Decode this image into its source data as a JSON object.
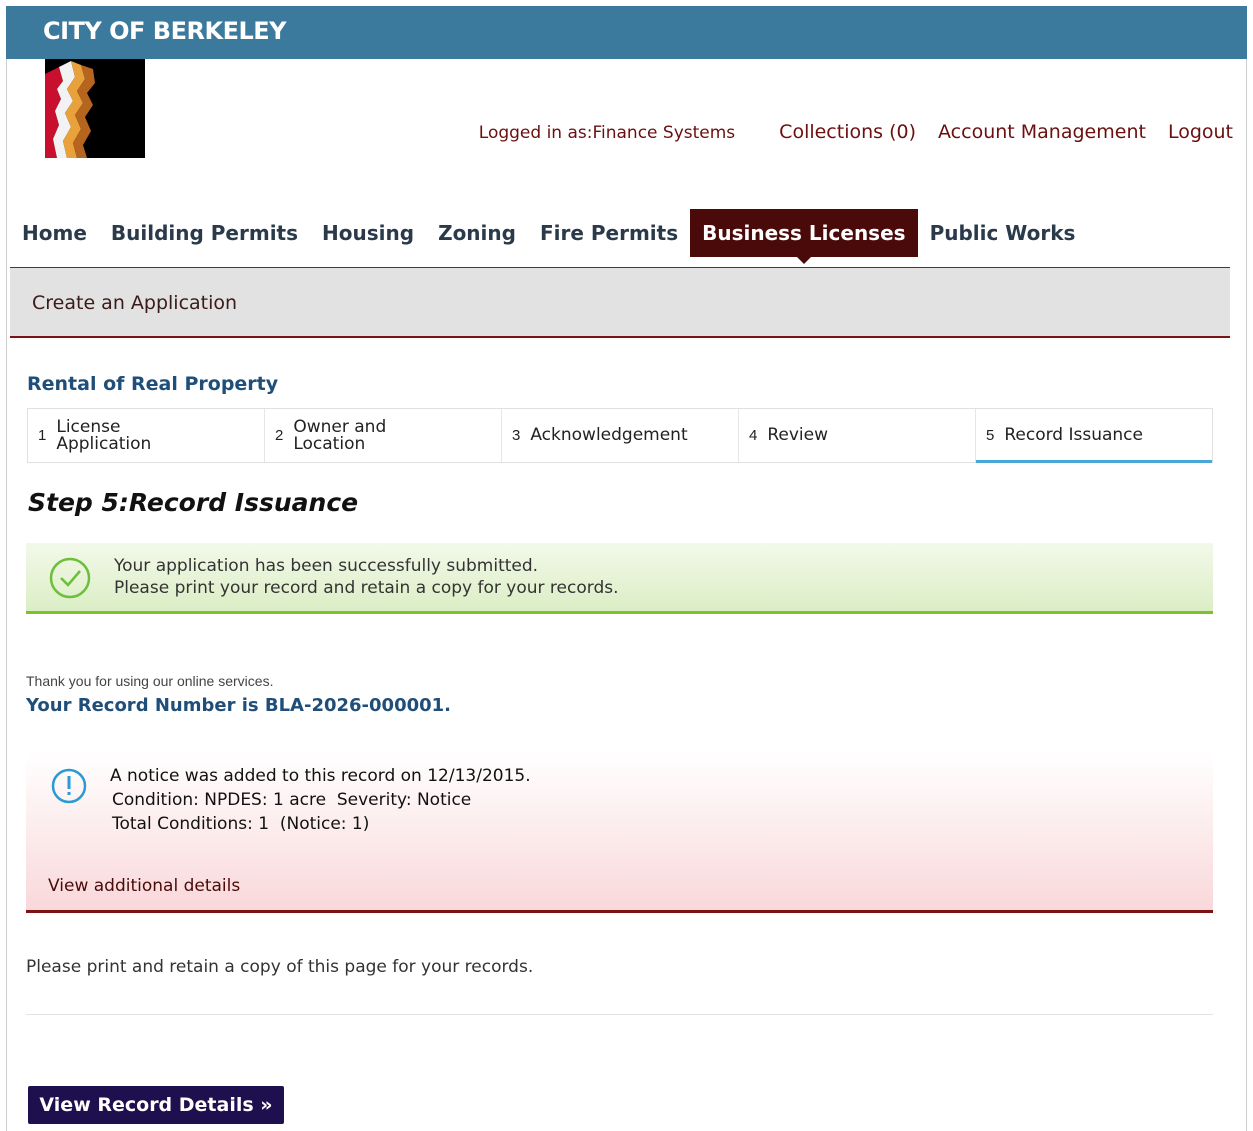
{
  "header": {
    "city": "CITY OF BERKELEY"
  },
  "usernav": {
    "logged_in": "Logged in as:Finance Systems",
    "collections": "Collections (0)",
    "account": "Account Management",
    "logout": "Logout"
  },
  "mainnav": {
    "items": [
      "Home",
      "Building Permits",
      "Housing",
      "Zoning",
      "Fire Permits",
      "Business Licenses",
      "Public Works"
    ],
    "active": "Business Licenses"
  },
  "createbar": {
    "label": "Create an Application"
  },
  "property_title": "Rental of Real Property",
  "steps": [
    {
      "num": "1",
      "label": "License Application"
    },
    {
      "num": "2",
      "label": "Owner and Location"
    },
    {
      "num": "3",
      "label": "Acknowledgement"
    },
    {
      "num": "4",
      "label": "Review"
    },
    {
      "num": "5",
      "label": "Record Issuance"
    }
  ],
  "step_heading": "Step 5:Record Issuance",
  "success": {
    "line1": "Your application has been successfully submitted.",
    "line2": "Please print your record and retain a copy for your records."
  },
  "thanks": "Thank you for using our online services.",
  "record_number": "Your Record Number is BLA-2026-000001.",
  "notice": {
    "line1": "A notice was added to this record on 12/13/2015.",
    "line2": "Condition: NPDES: 1 acre  Severity: Notice",
    "line3": "Total Conditions: 1  (Notice: 1)",
    "more": "View additional details"
  },
  "print_note": "Please print and retain a copy of this page for your records.",
  "button": {
    "label": "View Record Details »"
  },
  "colors": {
    "header": "#3b7a9c",
    "active_tab": "#4a0a0a",
    "link": "#6b0f0f",
    "title": "#1f4e79",
    "success": "#7dc12b",
    "button": "#1e0f4e"
  }
}
